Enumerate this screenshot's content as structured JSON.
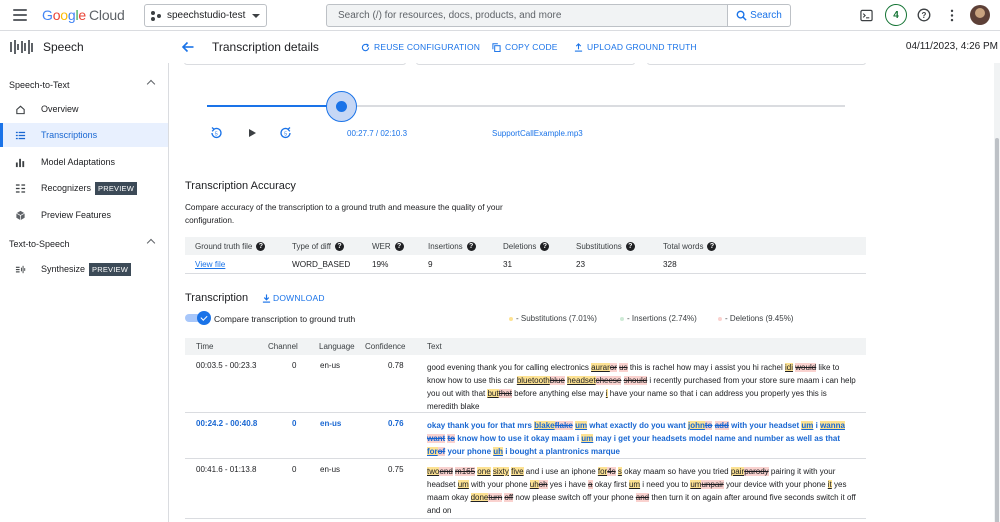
{
  "topbar": {
    "logo_google": "Google",
    "logo_cloud": "Cloud",
    "project": "speechstudio-test",
    "search_placeholder": "Search (/) for resources, docs, products, and more",
    "search_button": "Search",
    "notifications_count": "4"
  },
  "product": {
    "name": "Speech"
  },
  "header": {
    "title": "Transcription details",
    "reuse": "REUSE CONFIGURATION",
    "copy": "COPY CODE",
    "upload": "UPLOAD GROUND TRUTH",
    "date": "04/11/2023, 4:26 PM"
  },
  "sidebar": {
    "sections": [
      {
        "title": "Speech-to-Text",
        "items": [
          {
            "label": "Overview",
            "icon": "home-icon"
          },
          {
            "label": "Transcriptions",
            "icon": "list-icon",
            "active": true
          },
          {
            "label": "Model Adaptations",
            "icon": "chart-icon"
          },
          {
            "label": "Recognizers",
            "icon": "recognizer-icon",
            "badge": "PREVIEW"
          },
          {
            "label": "Preview Features",
            "icon": "hexagon-icon"
          }
        ]
      },
      {
        "title": "Text-to-Speech",
        "items": [
          {
            "label": "Synthesize",
            "icon": "synthesize-icon",
            "badge": "PREVIEW"
          }
        ]
      }
    ]
  },
  "player": {
    "progress": 0.211,
    "time": "00:27.7 / 02:10.3",
    "file": "SupportCallExample.mp3"
  },
  "accuracy": {
    "title": "Transcription Accuracy",
    "description": "Compare accuracy of the transcription to a ground truth and measure the quality of your configuration.",
    "headers": [
      "Ground truth file",
      "Type of diff",
      "WER",
      "Insertions",
      "Deletions",
      "Substitutions",
      "Total words"
    ],
    "row": [
      "View file",
      "WORD_BASED",
      "19%",
      "9",
      "31",
      "23",
      "328"
    ]
  },
  "transcription": {
    "title": "Transcription",
    "download": "DOWNLOAD",
    "toggle_label": "Compare transcription to ground truth",
    "legend": {
      "substitutions": "- Substitutions (7.01%)",
      "insertions": "- Insertions (2.74%)",
      "deletions": "- Deletions (9.45%)"
    },
    "colors": {
      "substitution": "#fde293",
      "insertion": "#ceead6",
      "deletion": "#fad2cf",
      "accent": "#1a73e8"
    },
    "headers": [
      "Time",
      "Channel",
      "Language",
      "Confidence",
      "Text"
    ],
    "rows": [
      {
        "time": "00:03.5 - 00:23.3",
        "channel": "0",
        "language": "en-us",
        "confidence": "0.78",
        "segments": [
          [
            "n",
            "good evening thank you for calling electronics "
          ],
          [
            "s",
            "aurar"
          ],
          [
            "d",
            "or"
          ],
          [
            "n",
            " "
          ],
          [
            "d",
            "us"
          ],
          [
            "n",
            " this is rachel how may i assist you hi rachel "
          ],
          [
            "s",
            "idi"
          ],
          [
            "n",
            " "
          ],
          [
            "d",
            "would"
          ],
          [
            "n",
            " like to know how to use this car "
          ],
          [
            "s",
            "bluetooth"
          ],
          [
            "d",
            "blue"
          ],
          [
            "n",
            " "
          ],
          [
            "s",
            "headset"
          ],
          [
            "d",
            "cheese"
          ],
          [
            "n",
            " "
          ],
          [
            "d",
            "should"
          ],
          [
            "n",
            " i recently purchased from your store sure maam i can help you out with that "
          ],
          [
            "s",
            "but"
          ],
          [
            "d",
            "that"
          ],
          [
            "n",
            " before anything else may "
          ],
          [
            "s",
            "i"
          ],
          [
            "n",
            " have your name so that i can address you properly yes this is meredith blake"
          ]
        ]
      },
      {
        "time": "00:24.2 - 00:40.8",
        "channel": "0",
        "language": "en-us",
        "confidence": "0.76",
        "selected": true,
        "segments": [
          [
            "n",
            "okay thank you for that mrs "
          ],
          [
            "s",
            "blake"
          ],
          [
            "d",
            "flake"
          ],
          [
            "n",
            " "
          ],
          [
            "s",
            "um"
          ],
          [
            "n",
            " what exactly do you want "
          ],
          [
            "s",
            "john"
          ],
          [
            "d",
            "to"
          ],
          [
            "n",
            " "
          ],
          [
            "d",
            "add"
          ],
          [
            "n",
            " with your headset "
          ],
          [
            "s",
            "um"
          ],
          [
            "n",
            " i "
          ],
          [
            "s",
            "wanna"
          ],
          [
            "n",
            " "
          ],
          [
            "d",
            "want"
          ],
          [
            "n",
            " "
          ],
          [
            "d",
            "to"
          ],
          [
            "n",
            " know how to use it okay maam i "
          ],
          [
            "s",
            "um"
          ],
          [
            "n",
            " may i get your headsets model name and number as well as that "
          ],
          [
            "s",
            "for"
          ],
          [
            "d",
            "of"
          ],
          [
            "n",
            " your phone "
          ],
          [
            "s",
            "uh"
          ],
          [
            "n",
            " i bought a plantronics marque"
          ]
        ]
      },
      {
        "time": "00:41.6 - 01:13.8",
        "channel": "0",
        "language": "en-us",
        "confidence": "0.75",
        "segments": [
          [
            "s",
            "two"
          ],
          [
            "d",
            "end"
          ],
          [
            "n",
            " "
          ],
          [
            "d",
            "m165"
          ],
          [
            "n",
            " "
          ],
          [
            "s",
            "one"
          ],
          [
            "n",
            " "
          ],
          [
            "s",
            "sixty"
          ],
          [
            "n",
            " "
          ],
          [
            "s",
            "five"
          ],
          [
            "n",
            " and i use an iphone "
          ],
          [
            "s",
            "for"
          ],
          [
            "d",
            "4s"
          ],
          [
            "n",
            " "
          ],
          [
            "s",
            "s"
          ],
          [
            "n",
            " okay maam so have you tried "
          ],
          [
            "s",
            "pair"
          ],
          [
            "d",
            "parody"
          ],
          [
            "n",
            " pairing it with your headset "
          ],
          [
            "s",
            "um"
          ],
          [
            "n",
            " with your phone "
          ],
          [
            "s",
            "uh"
          ],
          [
            "d",
            "oh"
          ],
          [
            "n",
            " yes i have "
          ],
          [
            "d",
            "a"
          ],
          [
            "n",
            " okay first "
          ],
          [
            "s",
            "um"
          ],
          [
            "n",
            " i need you to "
          ],
          [
            "s",
            "um"
          ],
          [
            "d",
            "unpair"
          ],
          [
            "n",
            " your device with your phone "
          ],
          [
            "s",
            "it"
          ],
          [
            "n",
            " yes maam okay "
          ],
          [
            "s",
            "done"
          ],
          [
            "d",
            "turn"
          ],
          [
            "n",
            " "
          ],
          [
            "d",
            "off"
          ],
          [
            "n",
            " now please switch off your phone "
          ],
          [
            "d",
            "and"
          ],
          [
            "n",
            " then turn it on again after around five seconds switch it off and on"
          ]
        ]
      }
    ]
  }
}
